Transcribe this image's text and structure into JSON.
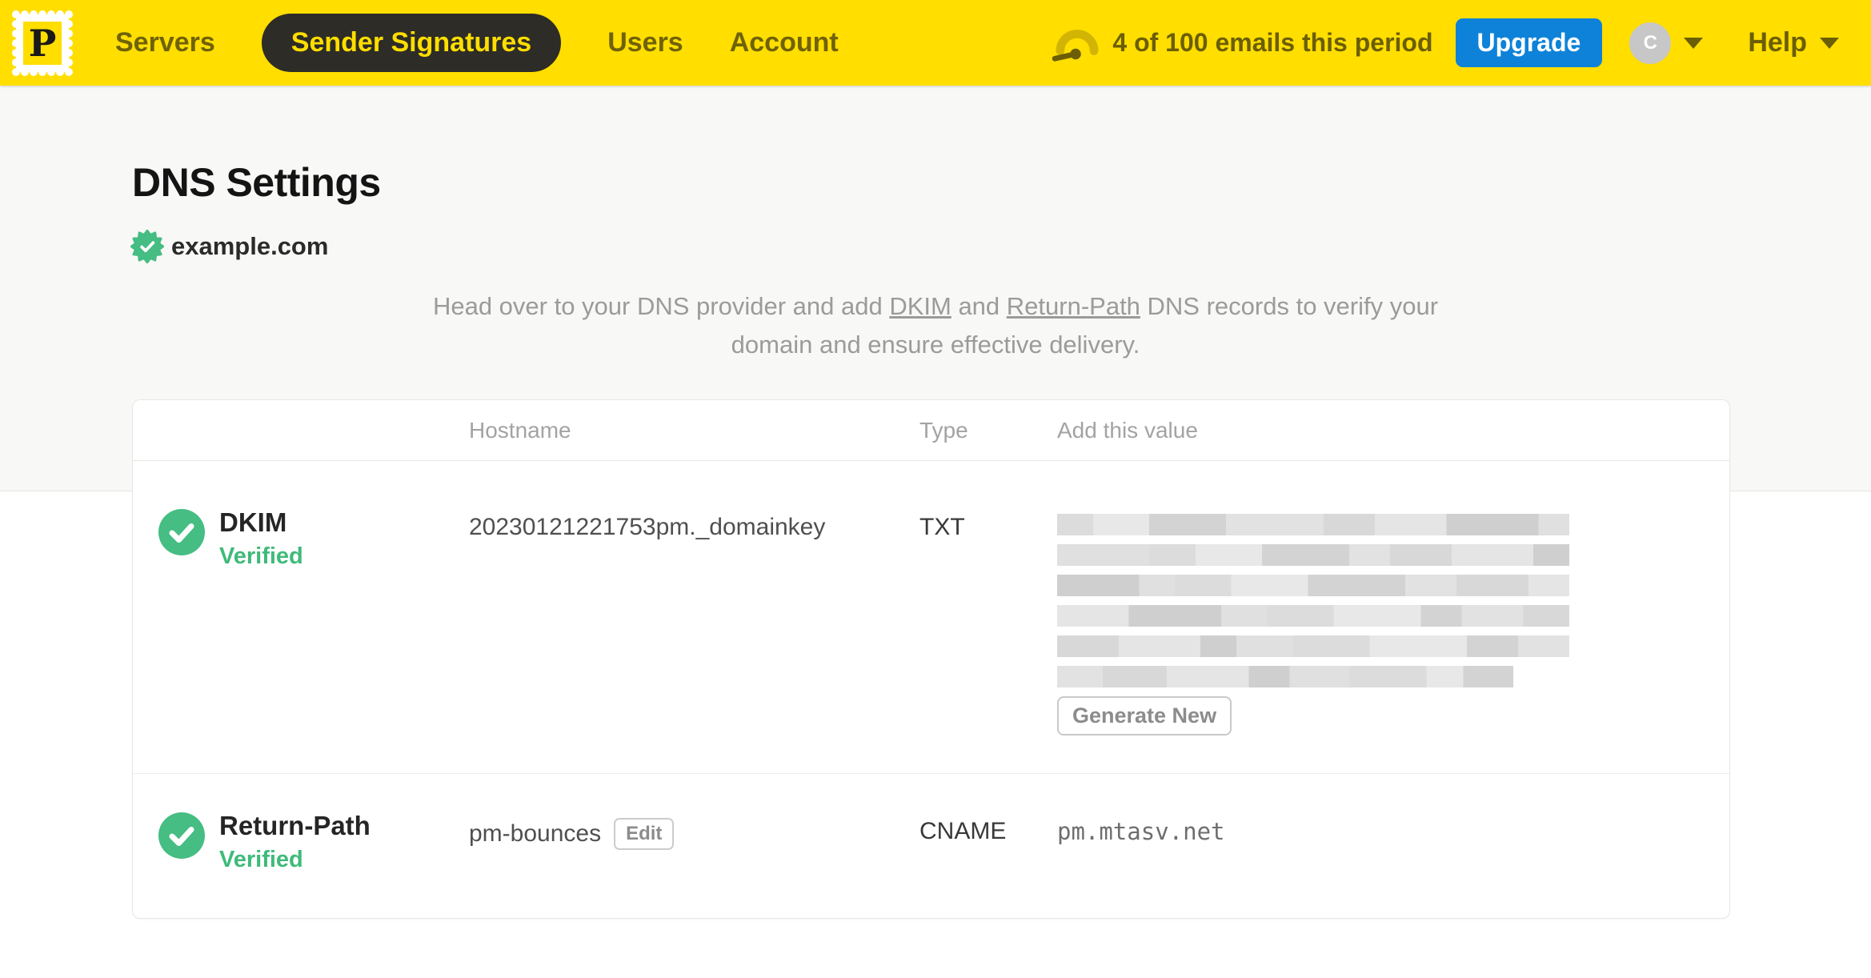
{
  "topbar": {
    "logo_letter": "P",
    "nav": [
      {
        "label": "Servers",
        "active": false
      },
      {
        "label": "Sender Signatures",
        "active": true
      },
      {
        "label": "Users",
        "active": false
      },
      {
        "label": "Account",
        "active": false
      }
    ],
    "usage_text": "4 of 100 emails this period",
    "upgrade_label": "Upgrade",
    "avatar_initial": "C",
    "help_label": "Help"
  },
  "page": {
    "title": "DNS Settings",
    "domain": "example.com",
    "domain_verified": true,
    "description": {
      "prefix": "Head over to your DNS provider and add ",
      "link1": "DKIM",
      "middle": " and ",
      "link2": "Return-Path",
      "suffix": " DNS records to verify your domain and ensure effective delivery."
    }
  },
  "table": {
    "headers": {
      "hostname": "Hostname",
      "type": "Type",
      "value": "Add this value"
    },
    "rows": [
      {
        "name": "DKIM",
        "status": "Verified",
        "hostname": "20230121221753pm._domainkey",
        "type": "TXT",
        "value_redacted": true,
        "redacted_lines_pct": [
          100,
          100,
          100,
          100,
          100,
          89
        ],
        "action_label": "Generate New"
      },
      {
        "name": "Return-Path",
        "status": "Verified",
        "hostname": "pm-bounces",
        "hostname_action": "Edit",
        "type": "CNAME",
        "value": "pm.mtasv.net"
      }
    ]
  },
  "colors": {
    "brand_yellow": "#FFDE00",
    "active_pill": "#2d2c27",
    "upgrade_blue": "#0e82d8",
    "verified_green": "#3fba7a",
    "olive_text": "#6b5e04"
  }
}
